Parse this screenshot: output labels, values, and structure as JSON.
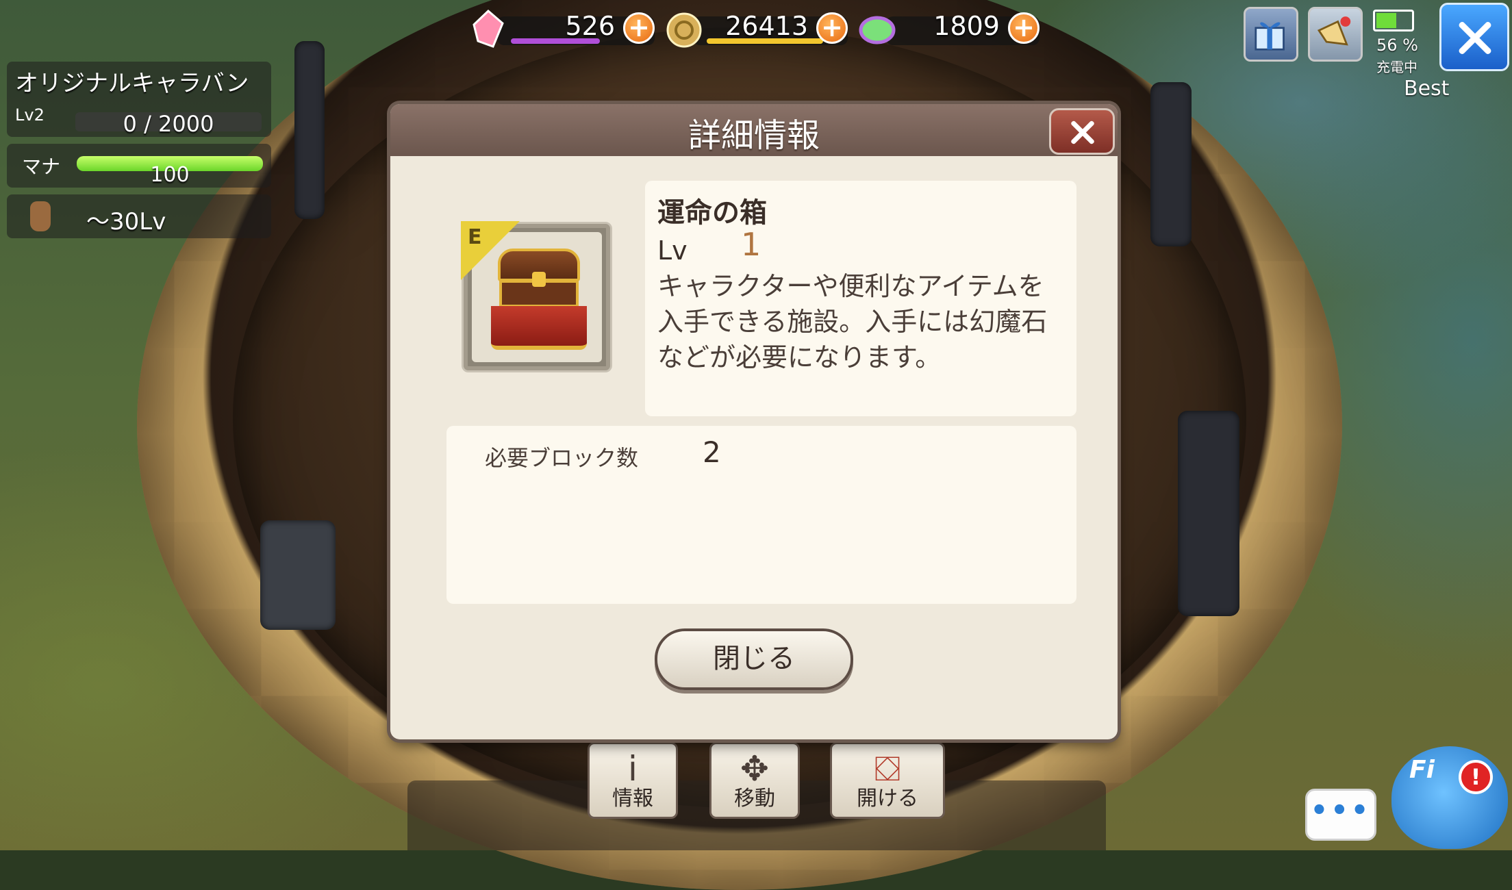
{
  "caravan": {
    "name": "オリジナルキャラバン",
    "level_label": "Lv2",
    "exp_text": "0 / 2000",
    "exp_progress": 0,
    "mana_label": "マナ",
    "mana_value": "100",
    "mana_progress": 1.0,
    "level_limit": "〜30Lv"
  },
  "currencies": [
    {
      "name": "magicite-crystal-icon",
      "value": "526",
      "color": "#b04fd8",
      "gauge": 0.65
    },
    {
      "name": "gil-coin-icon",
      "value": "26413",
      "color": "#f2c62e",
      "gauge": 0.8
    },
    {
      "name": "rainbow-gem-icon",
      "value": "1809",
      "color": "#6fcf6a",
      "gauge": 0
    }
  ],
  "status": {
    "battery_percent": "56 %",
    "charging_text": "充電中",
    "quality": "Best",
    "battery_level": 0.56
  },
  "dialog": {
    "title": "詳細情報",
    "item_name": "運命の箱",
    "item_rank": "E",
    "level_label": "Lv",
    "level_value": "1",
    "description": "キャラクターや便利なアイテムを入手できる施設。入手には幻魔石などが必要になります。",
    "required_blocks_label": "必要ブロック数",
    "required_blocks_value": "2",
    "close_button": "閉じる"
  },
  "actions": [
    {
      "label": "情報",
      "icon": "info-icon"
    },
    {
      "label": "移動",
      "icon": "move-arrows-icon"
    },
    {
      "label": "開ける",
      "icon": "open-chest-icon"
    }
  ],
  "chat_text": "•••",
  "mascot_text": "Fi",
  "alert_text": "!"
}
